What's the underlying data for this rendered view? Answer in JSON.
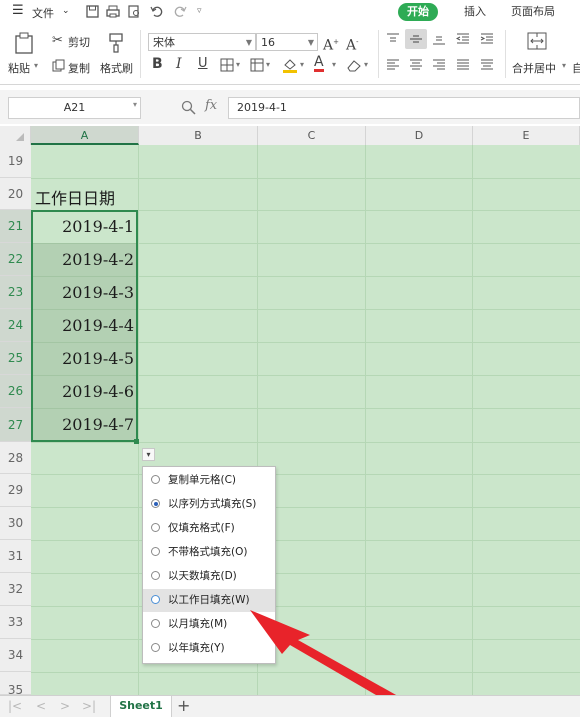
{
  "menubar": {
    "menu_icon": "hamburger-icon",
    "file_label": "文件",
    "file_arrow": "⌄",
    "tabs": [
      {
        "label": "开始",
        "active": true
      },
      {
        "label": "插入",
        "active": false
      },
      {
        "label": "页面布局",
        "active": false
      }
    ],
    "accent_color": "#2eab55"
  },
  "ribbon": {
    "paste_label": "粘贴",
    "cut_label": "剪切",
    "copy_label": "复制",
    "format_painter_label": "格式刷",
    "font_name": "宋体",
    "font_size": "16",
    "bold": "B",
    "italic": "I",
    "underline": "U",
    "merge_center_label": "合并居中",
    "merge_more": "自"
  },
  "formula_bar": {
    "name_box": "A21",
    "fx_label": "fx",
    "formula_value": "2019-4-1"
  },
  "columns": [
    "A",
    "B",
    "C",
    "D",
    "E"
  ],
  "rows": [
    "19",
    "20",
    "21",
    "22",
    "23",
    "24",
    "25",
    "26",
    "27",
    "28",
    "29",
    "30",
    "31",
    "32",
    "33",
    "34",
    "35"
  ],
  "cells": {
    "header": "工作日日期",
    "dates": [
      "2019-4-1",
      "2019-4-2",
      "2019-4-3",
      "2019-4-4",
      "2019-4-5",
      "2019-4-6",
      "2019-4-7"
    ]
  },
  "autofill_menu": {
    "button_glyph": "▾",
    "options": [
      {
        "label": "复制单元格(C)",
        "selected": false
      },
      {
        "label": "以序列方式填充(S)",
        "selected": true
      },
      {
        "label": "仅填充格式(F)",
        "selected": false
      },
      {
        "label": "不带格式填充(O)",
        "selected": false
      },
      {
        "label": "以天数填充(D)",
        "selected": false
      },
      {
        "label": "以工作日填充(W)",
        "selected": false,
        "hovered": true
      },
      {
        "label": "以月填充(M)",
        "selected": false
      },
      {
        "label": "以年填充(Y)",
        "selected": false
      }
    ]
  },
  "sheets": {
    "tabs": [
      "Sheet1"
    ],
    "add_label": "+"
  },
  "annotation_arrow_color": "#e8232a"
}
